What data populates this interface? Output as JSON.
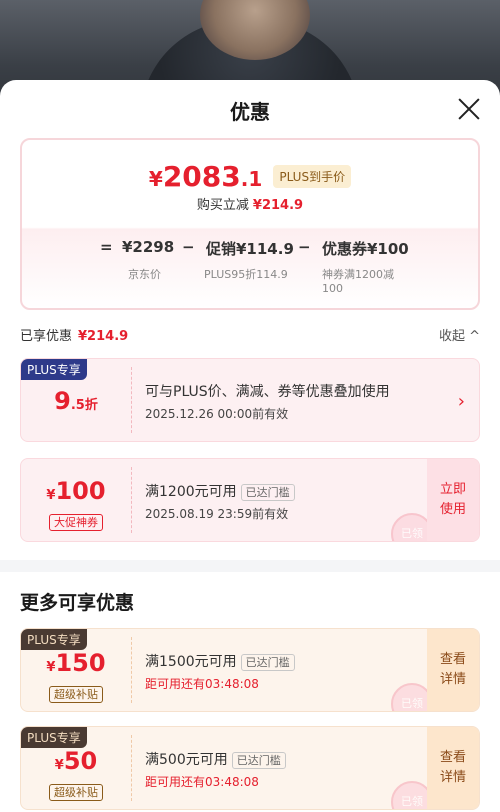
{
  "sheet": {
    "title": "优惠"
  },
  "summary": {
    "final_yen": "¥",
    "final_int": "2083",
    "final_dec": ".1",
    "plus_tag": "PLUS到手价",
    "reduce_label": "购买立减",
    "reduce_amount": "¥214.9",
    "formula": {
      "eq": "=",
      "base": "¥2298",
      "base_label": "京东价",
      "minus1": "−",
      "promo": "促销¥114.9",
      "promo_label": "PLUS95折114.9",
      "minus2": "−",
      "coupon": "优惠券¥100",
      "coupon_label": "神券满1200减",
      "coupon_label2": "100"
    }
  },
  "enjoyed": {
    "label": "已享优惠",
    "amount": "¥214.9",
    "collapse": "收起 ^"
  },
  "cards_enjoyed": [
    {
      "badge": "PLUS专享",
      "value_big": "9",
      "value_small": ".5折",
      "desc": "可与PLUS价、满减、券等优惠叠加使用",
      "validity": "2025.12.26 00:00前有效",
      "chevron": "›"
    },
    {
      "yen": "¥",
      "value": "100",
      "tag": "大促神券",
      "condition": "满1200元可用",
      "chip": "已达门槛",
      "validity": "2025.08.19 23:59前有效",
      "action": "立即\n使用",
      "stamp": "已领"
    }
  ],
  "more": {
    "title": "更多可享优惠",
    "cards": [
      {
        "badge": "PLUS专享",
        "yen": "¥",
        "value": "150",
        "tag": "超级补贴",
        "condition": "满1500元可用",
        "chip": "已达门槛",
        "countdown": "距可用还有03:48:08",
        "action": "查看\n详情",
        "stamp": "已领"
      },
      {
        "badge": "PLUS专享",
        "yen": "¥",
        "value": "50",
        "tag": "超级补贴",
        "condition": "满500元可用",
        "chip": "已达门槛",
        "countdown": "距可用还有03:48:08",
        "action": "查看\n详情",
        "stamp": "已领"
      }
    ]
  },
  "colors": {
    "accent_red": "#e5202e",
    "plus_blue": "#2e3a8a",
    "gold": "#8a5b1a"
  }
}
